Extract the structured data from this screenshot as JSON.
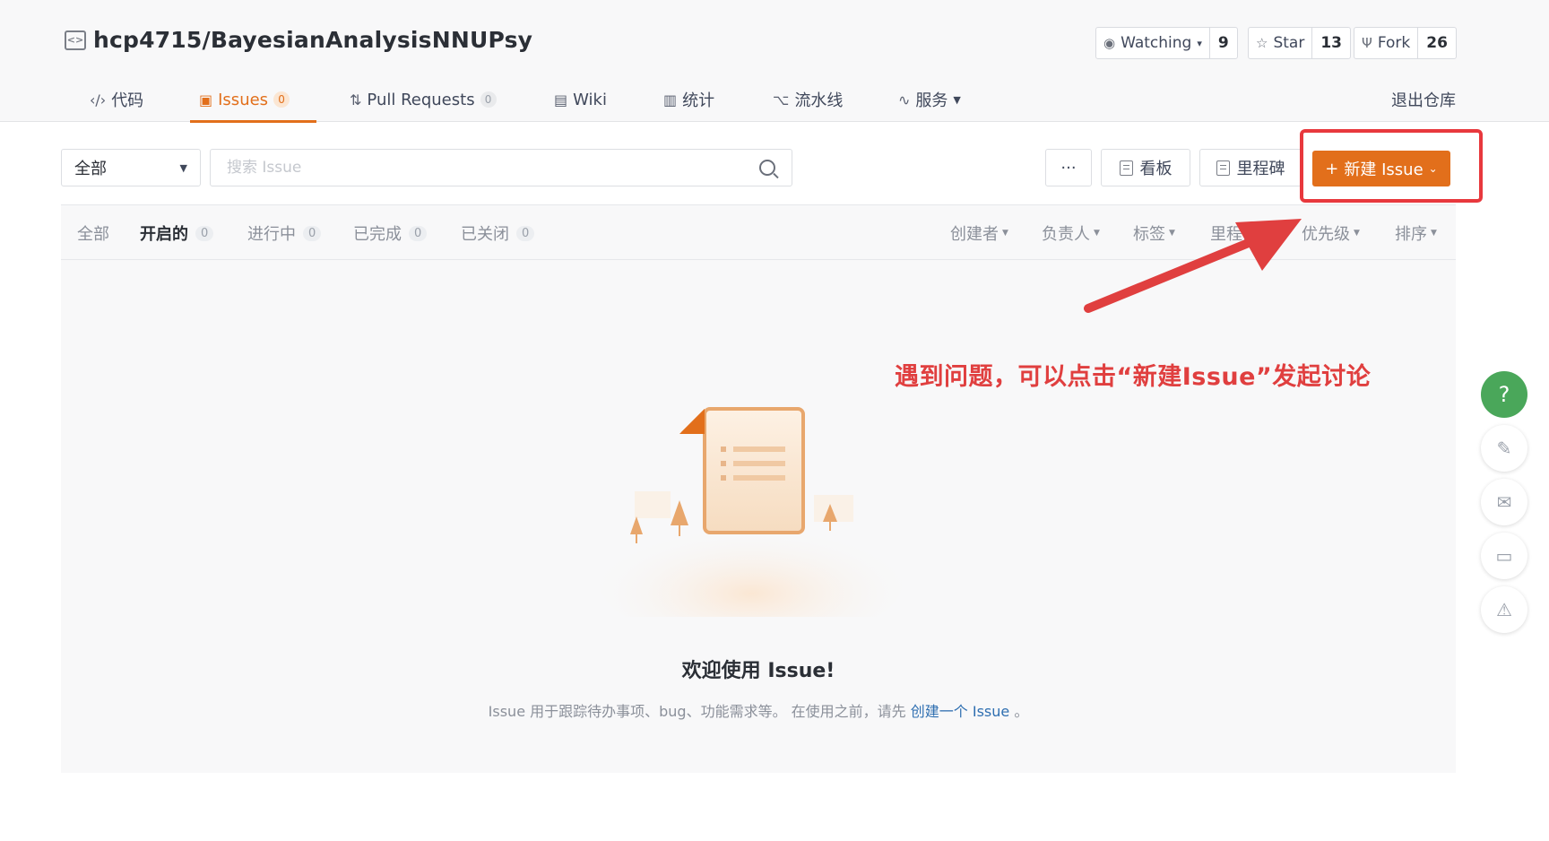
{
  "repo": {
    "name": "hcp4715/BayesianAnalysisNNUPsy",
    "icon": "code-repo-icon"
  },
  "counters": {
    "watching": {
      "label": "Watching",
      "count": "9",
      "icon": "eye-icon"
    },
    "star": {
      "label": "Star",
      "count": "13",
      "icon": "star-icon"
    },
    "fork": {
      "label": "Fork",
      "count": "26",
      "icon": "fork-icon"
    }
  },
  "nav": {
    "tabs": [
      {
        "label": "代码",
        "icon": "code-icon"
      },
      {
        "label": "Issues",
        "badge": "0",
        "icon": "issues-icon",
        "active": true
      },
      {
        "label": "Pull Requests",
        "badge": "0",
        "icon": "pull-request-icon"
      },
      {
        "label": "Wiki",
        "icon": "wiki-icon"
      },
      {
        "label": "统计",
        "icon": "stats-icon"
      },
      {
        "label": "流水线",
        "icon": "pipeline-icon"
      },
      {
        "label": "服务",
        "icon": "service-icon"
      }
    ],
    "exit_label": "退出仓库"
  },
  "toolbar": {
    "scope_select": "全部",
    "search_placeholder": "搜索 Issue",
    "more_label": "···",
    "board_label": "看板",
    "milestone_label": "里程碑",
    "new_issue_label": "新建 Issue"
  },
  "filters": {
    "tabs": [
      {
        "label": "全部"
      },
      {
        "label": "开启的",
        "count": "0",
        "active": true
      },
      {
        "label": "进行中",
        "count": "0"
      },
      {
        "label": "已完成",
        "count": "0"
      },
      {
        "label": "已关闭",
        "count": "0"
      }
    ],
    "sorts": [
      "创建者",
      "负责人",
      "标签",
      "里程碑",
      "优先级",
      "排序"
    ]
  },
  "empty": {
    "title": "欢迎使用 Issue!",
    "desc_prefix": "Issue 用于跟踪待办事项、bug、功能需求等。 在使用之前，请先",
    "desc_link": "创建一个 Issue",
    "desc_suffix": "。"
  },
  "annotation": {
    "text": "遇到问题，可以点击“新建Issue”发起讨论",
    "color": "#e03f3f"
  },
  "float_buttons": [
    "help-icon",
    "edit-icon",
    "mail-icon",
    "chat-icon",
    "warning-icon"
  ],
  "colors": {
    "accent": "#e26f1b",
    "help": "#4aa75a",
    "link": "#2f6fb1"
  }
}
